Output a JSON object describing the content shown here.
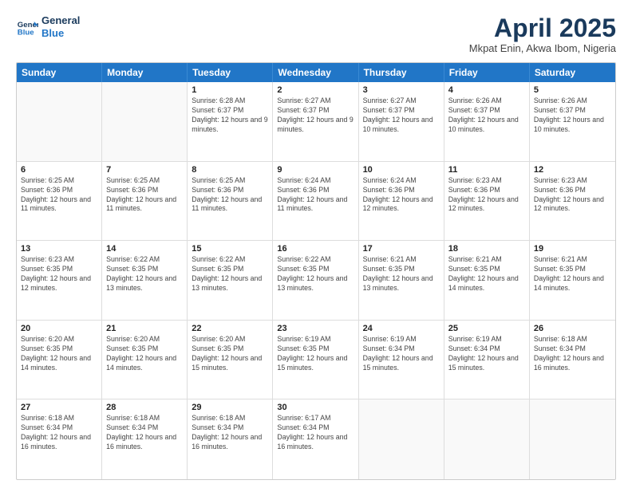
{
  "header": {
    "logo_line1": "General",
    "logo_line2": "Blue",
    "title": "April 2025",
    "location": "Mkpat Enin, Akwa Ibom, Nigeria"
  },
  "weekdays": [
    "Sunday",
    "Monday",
    "Tuesday",
    "Wednesday",
    "Thursday",
    "Friday",
    "Saturday"
  ],
  "rows": [
    [
      {
        "day": "",
        "info": ""
      },
      {
        "day": "",
        "info": ""
      },
      {
        "day": "1",
        "info": "Sunrise: 6:28 AM\nSunset: 6:37 PM\nDaylight: 12 hours and 9 minutes."
      },
      {
        "day": "2",
        "info": "Sunrise: 6:27 AM\nSunset: 6:37 PM\nDaylight: 12 hours and 9 minutes."
      },
      {
        "day": "3",
        "info": "Sunrise: 6:27 AM\nSunset: 6:37 PM\nDaylight: 12 hours and 10 minutes."
      },
      {
        "day": "4",
        "info": "Sunrise: 6:26 AM\nSunset: 6:37 PM\nDaylight: 12 hours and 10 minutes."
      },
      {
        "day": "5",
        "info": "Sunrise: 6:26 AM\nSunset: 6:37 PM\nDaylight: 12 hours and 10 minutes."
      }
    ],
    [
      {
        "day": "6",
        "info": "Sunrise: 6:25 AM\nSunset: 6:36 PM\nDaylight: 12 hours and 11 minutes."
      },
      {
        "day": "7",
        "info": "Sunrise: 6:25 AM\nSunset: 6:36 PM\nDaylight: 12 hours and 11 minutes."
      },
      {
        "day": "8",
        "info": "Sunrise: 6:25 AM\nSunset: 6:36 PM\nDaylight: 12 hours and 11 minutes."
      },
      {
        "day": "9",
        "info": "Sunrise: 6:24 AM\nSunset: 6:36 PM\nDaylight: 12 hours and 11 minutes."
      },
      {
        "day": "10",
        "info": "Sunrise: 6:24 AM\nSunset: 6:36 PM\nDaylight: 12 hours and 12 minutes."
      },
      {
        "day": "11",
        "info": "Sunrise: 6:23 AM\nSunset: 6:36 PM\nDaylight: 12 hours and 12 minutes."
      },
      {
        "day": "12",
        "info": "Sunrise: 6:23 AM\nSunset: 6:36 PM\nDaylight: 12 hours and 12 minutes."
      }
    ],
    [
      {
        "day": "13",
        "info": "Sunrise: 6:23 AM\nSunset: 6:35 PM\nDaylight: 12 hours and 12 minutes."
      },
      {
        "day": "14",
        "info": "Sunrise: 6:22 AM\nSunset: 6:35 PM\nDaylight: 12 hours and 13 minutes."
      },
      {
        "day": "15",
        "info": "Sunrise: 6:22 AM\nSunset: 6:35 PM\nDaylight: 12 hours and 13 minutes."
      },
      {
        "day": "16",
        "info": "Sunrise: 6:22 AM\nSunset: 6:35 PM\nDaylight: 12 hours and 13 minutes."
      },
      {
        "day": "17",
        "info": "Sunrise: 6:21 AM\nSunset: 6:35 PM\nDaylight: 12 hours and 13 minutes."
      },
      {
        "day": "18",
        "info": "Sunrise: 6:21 AM\nSunset: 6:35 PM\nDaylight: 12 hours and 14 minutes."
      },
      {
        "day": "19",
        "info": "Sunrise: 6:21 AM\nSunset: 6:35 PM\nDaylight: 12 hours and 14 minutes."
      }
    ],
    [
      {
        "day": "20",
        "info": "Sunrise: 6:20 AM\nSunset: 6:35 PM\nDaylight: 12 hours and 14 minutes."
      },
      {
        "day": "21",
        "info": "Sunrise: 6:20 AM\nSunset: 6:35 PM\nDaylight: 12 hours and 14 minutes."
      },
      {
        "day": "22",
        "info": "Sunrise: 6:20 AM\nSunset: 6:35 PM\nDaylight: 12 hours and 15 minutes."
      },
      {
        "day": "23",
        "info": "Sunrise: 6:19 AM\nSunset: 6:35 PM\nDaylight: 12 hours and 15 minutes."
      },
      {
        "day": "24",
        "info": "Sunrise: 6:19 AM\nSunset: 6:34 PM\nDaylight: 12 hours and 15 minutes."
      },
      {
        "day": "25",
        "info": "Sunrise: 6:19 AM\nSunset: 6:34 PM\nDaylight: 12 hours and 15 minutes."
      },
      {
        "day": "26",
        "info": "Sunrise: 6:18 AM\nSunset: 6:34 PM\nDaylight: 12 hours and 16 minutes."
      }
    ],
    [
      {
        "day": "27",
        "info": "Sunrise: 6:18 AM\nSunset: 6:34 PM\nDaylight: 12 hours and 16 minutes."
      },
      {
        "day": "28",
        "info": "Sunrise: 6:18 AM\nSunset: 6:34 PM\nDaylight: 12 hours and 16 minutes."
      },
      {
        "day": "29",
        "info": "Sunrise: 6:18 AM\nSunset: 6:34 PM\nDaylight: 12 hours and 16 minutes."
      },
      {
        "day": "30",
        "info": "Sunrise: 6:17 AM\nSunset: 6:34 PM\nDaylight: 12 hours and 16 minutes."
      },
      {
        "day": "",
        "info": ""
      },
      {
        "day": "",
        "info": ""
      },
      {
        "day": "",
        "info": ""
      }
    ]
  ]
}
